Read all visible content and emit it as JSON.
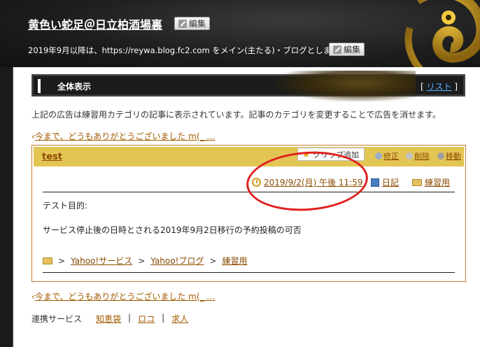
{
  "header": {
    "blog_title": "黄色い蛇足＠日立柏酒場裏",
    "edit_label": "編集",
    "description": "2019年9月以降は、https://reywa.blog.fc2.com をメイン(主たる)・ブログとします。",
    "description_edit_label": "編集"
  },
  "nav": {
    "title": "全体表示",
    "list_open": "[",
    "list_label": "リスト",
    "list_close": "]"
  },
  "notice": "上記の広告は練習用カテゴリの記事に表示されています。記事のカテゴリを変更することで広告を消せます。",
  "prev_link_top": "今まで、どうもありがとうございました m(_ …",
  "prev_link_bottom": "今まで、どうもありがとうございました m(_ …",
  "entry": {
    "title": "test",
    "clip_label": "クリップ追加",
    "actions": {
      "edit": "修正",
      "delete": "削除",
      "move": "移動"
    },
    "datetime": "2019/9/2(月) 午後 11:59",
    "category_diary": "日記",
    "category_practice": "練習用",
    "body_line1": "テスト目的:",
    "body_line2": "サービス停止後の日時とされる2019年9月2日移行の予約投稿の可否",
    "breadcrumbs": [
      "Yahoo!サービス",
      "Yahoo!ブログ",
      "練習用"
    ]
  },
  "services": {
    "label": "連携サービス",
    "items": [
      "知恵袋",
      "ロコ",
      "求人"
    ]
  }
}
